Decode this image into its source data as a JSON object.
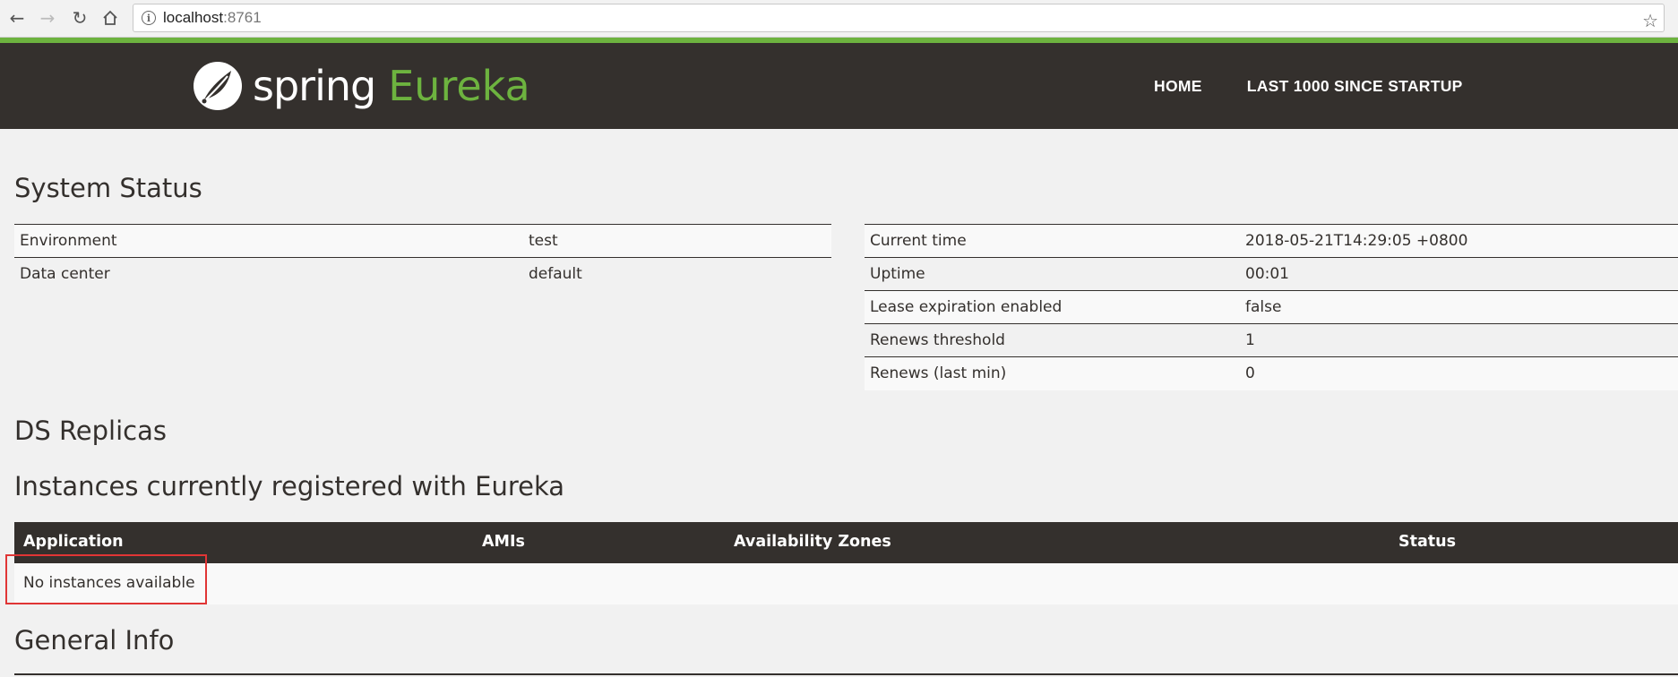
{
  "browser": {
    "url_host": "localhost",
    "url_port": ":8761"
  },
  "header": {
    "logo_spring": "spring",
    "logo_eureka": "Eureka",
    "nav": [
      "HOME",
      "LAST 1000 SINCE STARTUP"
    ]
  },
  "system_status": {
    "title": "System Status",
    "left": [
      {
        "label": "Environment",
        "value": "test"
      },
      {
        "label": "Data center",
        "value": "default"
      }
    ],
    "right": [
      {
        "label": "Current time",
        "value": "2018-05-21T14:29:05 +0800"
      },
      {
        "label": "Uptime",
        "value": "00:01"
      },
      {
        "label": "Lease expiration enabled",
        "value": "false"
      },
      {
        "label": "Renews threshold",
        "value": "1"
      },
      {
        "label": "Renews (last min)",
        "value": "0"
      }
    ]
  },
  "ds_replicas": {
    "title": "DS Replicas"
  },
  "instances": {
    "title": "Instances currently registered with Eureka",
    "columns": [
      "Application",
      "AMIs",
      "Availability Zones",
      "Status"
    ],
    "empty_message": "No instances available"
  },
  "general_info": {
    "title": "General Info"
  },
  "colors": {
    "header_bg": "#34302d",
    "accent_green": "#6db33f",
    "highlight_red": "#e03535"
  }
}
